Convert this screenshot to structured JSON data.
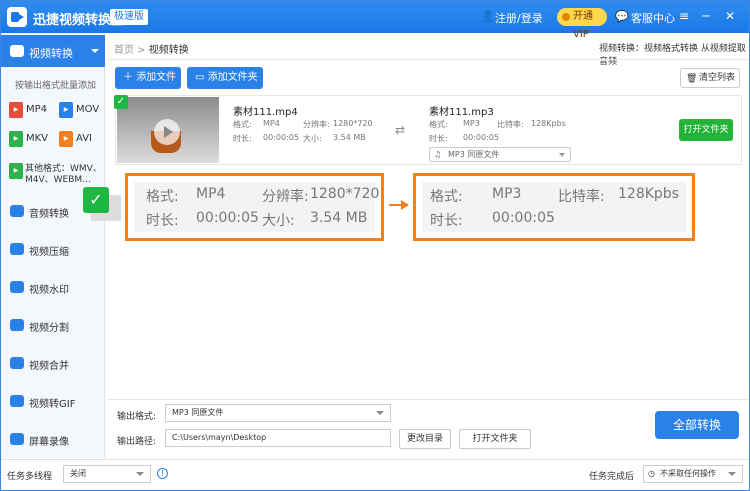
{
  "app": {
    "title": "迅捷视频转换器",
    "edition": "极速版",
    "login": "注册/登录",
    "vip": "开通VIP",
    "service": "客服中心"
  },
  "sidebar": {
    "active": "视频转换",
    "hint": "按输出格式批量添加",
    "formats": [
      "MP4",
      "MOV",
      "MKV",
      "AVI"
    ],
    "other_line1": "其他格式：WMV、",
    "other_line2": "M4V、WEBM…",
    "items": [
      "音频转换",
      "视频压缩",
      "视频水印",
      "视频分割",
      "视频合并",
      "视频转GIF",
      "屏幕录像"
    ]
  },
  "breadcrumb": {
    "home": "首页",
    "sep": ">",
    "current": "视频转换",
    "tip": "视频转换：视频格式转换 从视频提取音频"
  },
  "toolbar": {
    "add_file": "添加文件",
    "add_folder": "添加文件夹",
    "clear": "清空列表"
  },
  "file": {
    "src_name": "素材111.mp4",
    "src_fmt_label": "格式:",
    "src_fmt": "MP4",
    "src_res_label": "分辨率:",
    "src_res": "1280*720",
    "src_dur_label": "时长:",
    "src_dur": "00:00:05",
    "src_size_label": "大小:",
    "src_size": "3.54 MB",
    "dst_name": "素材111.mp3",
    "dst_fmt_label": "格式:",
    "dst_fmt": "MP3",
    "dst_br_label": "比特率:",
    "dst_br": "128Kpbs",
    "dst_dur_label": "时长:",
    "dst_dur": "00:00:05",
    "dst_select": "MP3  同原文件",
    "open_folder": "打开文件夹"
  },
  "zoom": {
    "left": {
      "fmt_label": "格式:",
      "fmt": "MP4",
      "res_label": "分辨率:",
      "res": "1280*720",
      "dur_label": "时长:",
      "dur": "00:00:05",
      "size_label": "大小:",
      "size": "3.54 MB"
    },
    "right": {
      "fmt_label": "格式:",
      "fmt": "MP3",
      "br_label": "比特率:",
      "br": "128Kpbs",
      "dur_label": "时长:",
      "dur": "00:00:05"
    }
  },
  "output": {
    "format_label": "输出格式:",
    "format": "MP3  同原文件",
    "path_label": "输出路径:",
    "path": "C:\\Users\\mayn\\Desktop",
    "change_dir": "更改目录",
    "open_folder": "打开文件夹",
    "convert_all": "全部转换"
  },
  "status": {
    "threads_label": "任务多线程",
    "threads": "关闭",
    "after_label": "任务完成后",
    "after": "不采取任何操作"
  },
  "colors": {
    "primary": "#2a82e8",
    "green": "#1fb743",
    "orange": "#f08020",
    "vip": "#ffd84c"
  }
}
